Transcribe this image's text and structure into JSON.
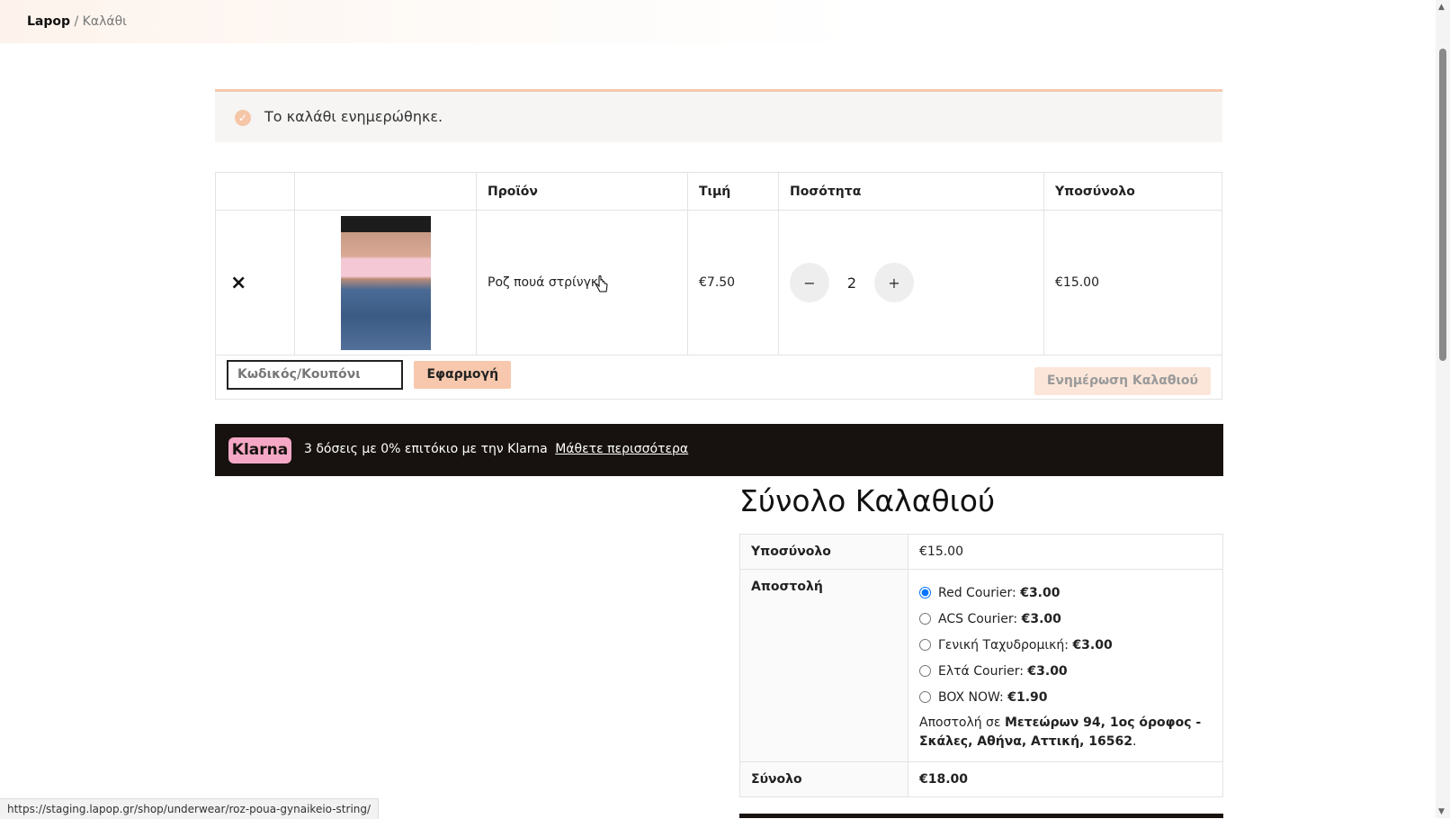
{
  "breadcrumb": {
    "home": "Lapop",
    "separator": " / ",
    "current": "Καλάθι"
  },
  "notice": {
    "message": "Το καλάθι ενημερώθηκε.",
    "icon": "check-circle-icon"
  },
  "cart": {
    "headers": [
      "",
      "",
      "Προϊόν",
      "Τιμή",
      "Ποσότητα",
      "Υποσύνολο"
    ],
    "items": [
      {
        "remove": "×",
        "name": "Ροζ πουά στρίνγκ",
        "price": "€7.50",
        "quantity": "2",
        "subtotal": "€15.00"
      }
    ],
    "qty_minus": "−",
    "qty_plus": "+",
    "coupon_placeholder": "Κωδικός/Κουπόνι",
    "apply_label": "Εφαρμογή",
    "update_label": "Ενημέρωση Καλαθιού"
  },
  "klarna": {
    "logo": "Klarna",
    "text": "3 δόσεις με 0% επιτόκιο με την Klarna",
    "link": "Μάθετε περισσότερα"
  },
  "totals": {
    "title": "Σύνολο Καλαθιού",
    "subtotal_label": "Υποσύνολο",
    "subtotal_value": "€15.00",
    "shipping_label": "Αποστολή",
    "shipping_options": [
      {
        "name": "Red Courier:",
        "price": "€3.00",
        "selected": true
      },
      {
        "name": "ACS Courier:",
        "price": "€3.00",
        "selected": false
      },
      {
        "name": "Γενική Ταχυδρομική:",
        "price": "€3.00",
        "selected": false
      },
      {
        "name": "Ελτά Courier:",
        "price": "€3.00",
        "selected": false
      },
      {
        "name": "BOX NOW:",
        "price": "€1.90",
        "selected": false
      }
    ],
    "ship_to_prefix": "Αποστολή σε",
    "ship_to_address": "Μετεώρων 94, 1ος όροφος - Σκάλες, Αθήνα, Αττική, 16562",
    "ship_to_suffix": ".",
    "total_label": "Σύνολο",
    "total_value": "€18.00"
  },
  "status_bar": {
    "url": "https://staging.lapop.gr/shop/underwear/roz-poua-gynaikeio-string/"
  },
  "colors": {
    "accent": "#f7c8ad",
    "klarna_bg": "#17120f",
    "klarna_pink": "#f5a8c5"
  }
}
